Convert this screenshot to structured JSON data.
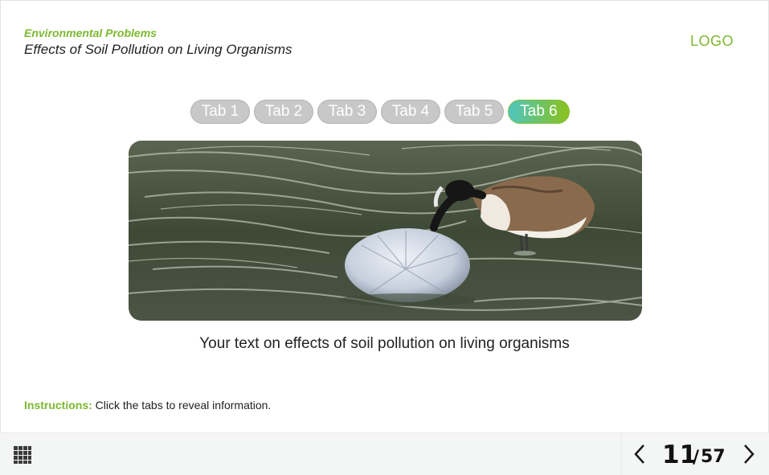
{
  "header": {
    "category": "Environmental Problems",
    "title": "Effects of Soil Pollution on Living Organisms",
    "logo": "LOGO"
  },
  "tabs": [
    {
      "label": "Tab 1",
      "active": false
    },
    {
      "label": "Tab 2",
      "active": false
    },
    {
      "label": "Tab 3",
      "active": false
    },
    {
      "label": "Tab 4",
      "active": false
    },
    {
      "label": "Tab 5",
      "active": false
    },
    {
      "label": "Tab 6",
      "active": true
    }
  ],
  "content": {
    "image": "goose-with-plastic-bag-in-water",
    "caption": "Your text on effects of soil pollution on living organisms"
  },
  "instructions": {
    "label": "Instructions:",
    "text": " Click the tabs to reveal information."
  },
  "footer": {
    "menu_icon": "grid-menu-icon",
    "current_page": "11",
    "separator": "/",
    "total_pages": "57"
  },
  "colors": {
    "accent": "#7cb82f",
    "tab_inactive": "#c8c8c8",
    "tab_active_gradient": [
      "#4fc6c4",
      "#8cc21a"
    ]
  }
}
